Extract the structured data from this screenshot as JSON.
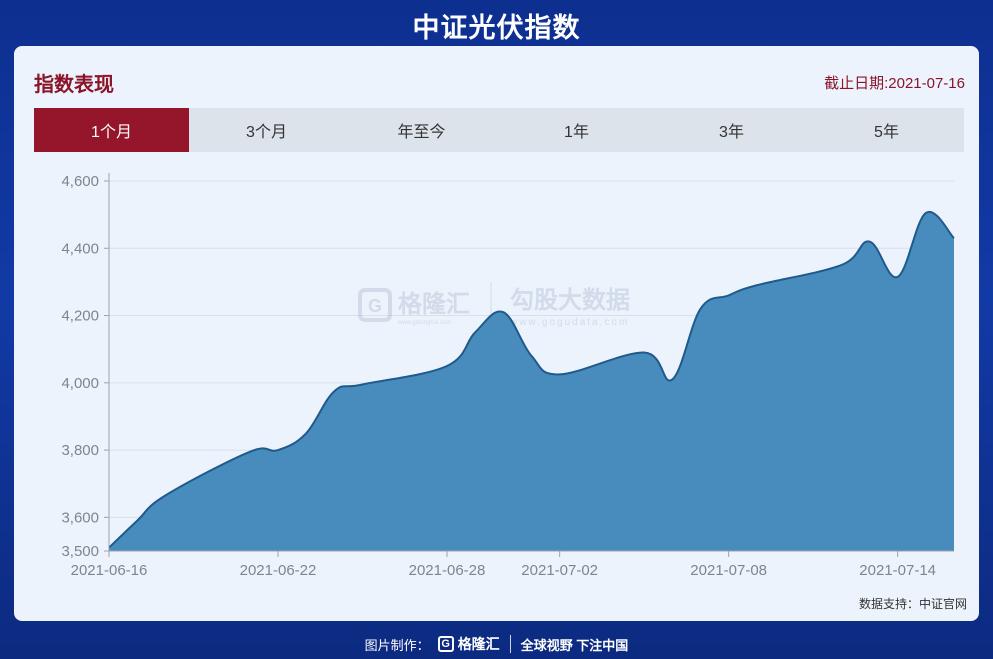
{
  "page": {
    "title": "中证光伏指数"
  },
  "card": {
    "section_title": "指数表现",
    "as_of": "截止日期:2021-07-16",
    "tabs": [
      "1个月",
      "3个月",
      "年至今",
      "1年",
      "3年",
      "5年"
    ],
    "active_tab": 0,
    "source": "数据支持：中证官网"
  },
  "watermark": {
    "brand_cn": "格隆汇",
    "brand_url": "www.gelonghui.com",
    "partner_cn": "勾股大数据",
    "partner_url": "www.gogudata.com"
  },
  "footer": {
    "made_by": "图片制作：",
    "logo_letter": "G",
    "brand": "格隆汇",
    "slogan": "全球视野 下注中国"
  },
  "colors": {
    "background": "#123aa6",
    "accent": "#95152a",
    "area_fill": "#3f86b9",
    "line": "#1f5a8c"
  },
  "chart_data": {
    "type": "area",
    "title": "",
    "xlabel": "",
    "ylabel": "",
    "ylim": [
      3500,
      4600
    ],
    "yticks": [
      3500,
      3600,
      3800,
      4000,
      4200,
      4400,
      4600
    ],
    "ytick_labels": [
      "3,500",
      "3,600",
      "3,800",
      "4,000",
      "4,200",
      "4,400",
      "4,600"
    ],
    "xlim": [
      "2021-06-16",
      "2021-07-16"
    ],
    "xticks": [
      "2021-06-16",
      "2021-06-22",
      "2021-06-28",
      "2021-07-02",
      "2021-07-08",
      "2021-07-14"
    ],
    "grid": "horizontal",
    "series": [
      {
        "x": [
          "2021-06-16",
          "2021-06-17",
          "2021-06-18",
          "2021-06-21",
          "2021-06-22",
          "2021-06-23",
          "2021-06-24",
          "2021-06-25",
          "2021-06-28",
          "2021-06-29",
          "2021-06-30",
          "2021-07-01",
          "2021-07-02",
          "2021-07-05",
          "2021-07-06",
          "2021-07-07",
          "2021-07-08",
          "2021-07-09",
          "2021-07-12",
          "2021-07-13",
          "2021-07-14",
          "2021-07-15",
          "2021-07-16"
        ],
        "values": [
          3510,
          3590,
          3665,
          3795,
          3800,
          3850,
          3975,
          3995,
          4050,
          4150,
          4210,
          4080,
          4025,
          4090,
          4010,
          4220,
          4260,
          4290,
          4350,
          4420,
          4315,
          4505,
          4430
        ]
      }
    ]
  }
}
